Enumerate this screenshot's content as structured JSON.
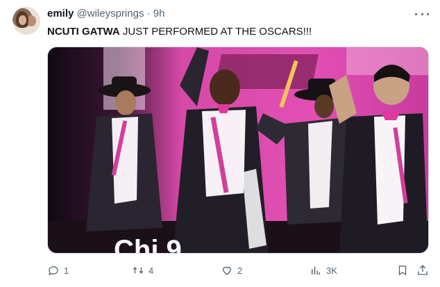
{
  "tweet": {
    "author_name": "emily",
    "author_handle": "@wileysprings",
    "separator": "·",
    "time": "9h",
    "text_bold": "NCUTI GATWA",
    "text_rest": " JUST PERFORMED AT THE OSCARS!!!"
  },
  "media": {
    "caption_overlay": "Chi  9"
  },
  "actions": {
    "reply_count": "1",
    "retweet_count": "4",
    "like_count": "2",
    "views_count": "3K"
  },
  "icons": {
    "more": "more-horizontal-icon",
    "reply": "reply-icon",
    "retweet": "retweet-icon",
    "like": "heart-icon",
    "views": "views-icon",
    "bookmark": "bookmark-icon",
    "share": "share-icon"
  },
  "colors": {
    "text_primary": "#0f1419",
    "text_secondary": "#536471",
    "stage_pink": "#d93fb0"
  }
}
